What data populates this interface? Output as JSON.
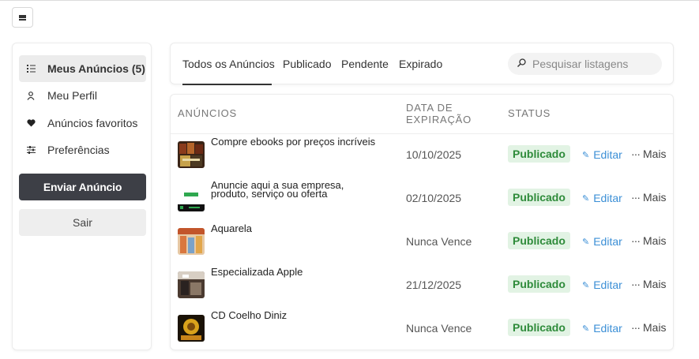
{
  "menu": {
    "icon": "hamburger-icon"
  },
  "sidebar": {
    "items": [
      {
        "label": "Meus Anúncios (5)",
        "icon": "list-icon",
        "active": true
      },
      {
        "label": "Meu Perfil",
        "icon": "user-icon"
      },
      {
        "label": "Anúncios favoritos",
        "icon": "heart-icon"
      },
      {
        "label": "Preferências",
        "icon": "sliders-icon"
      }
    ],
    "send_label": "Enviar Anúncio",
    "exit_label": "Sair"
  },
  "tabs": [
    {
      "label": "Todos os Anúncios",
      "active": true
    },
    {
      "label": "Publicado"
    },
    {
      "label": "Pendente"
    },
    {
      "label": "Expirado"
    }
  ],
  "search": {
    "placeholder": "Pesquisar listagens",
    "icon": "search-icon"
  },
  "table": {
    "headers": {
      "ads": "ANÚNCIOS",
      "expiry_line1": "DATA DE",
      "expiry_line2": "EXPIRAÇÃO",
      "status": "STATUS"
    },
    "rows": [
      {
        "title": "Compre ebooks por preços incríveis",
        "expiry": "10/10/2025",
        "status": "Publicado",
        "edit": "Editar",
        "more": "Mais"
      },
      {
        "title": "Anuncie aqui a sua empresa, produto, serviço ou oferta",
        "expiry": "02/10/2025",
        "status": "Publicado",
        "edit": "Editar",
        "more": "Mais"
      },
      {
        "title": "Aquarela",
        "expiry": "Nunca Vence",
        "status": "Publicado",
        "edit": "Editar",
        "more": "Mais"
      },
      {
        "title": "Especializada Apple",
        "expiry": "21/12/2025",
        "status": "Publicado",
        "edit": "Editar",
        "more": "Mais"
      },
      {
        "title": "CD Coelho Diniz",
        "expiry": "Nunca Vence",
        "status": "Publicado",
        "edit": "Editar",
        "more": "Mais"
      }
    ]
  },
  "colors": {
    "accent_dark": "#3d3f46",
    "link": "#3b8fd6",
    "status_bg": "#e2f3e4",
    "status_text": "#2e8b3a"
  }
}
